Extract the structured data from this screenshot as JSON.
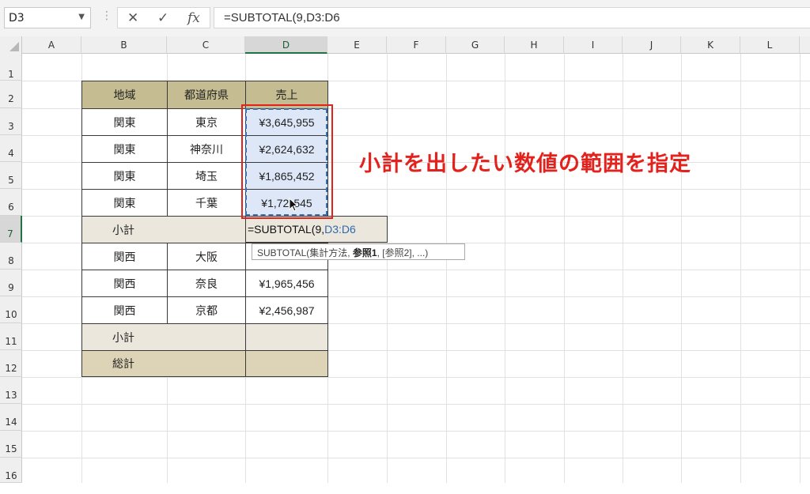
{
  "formula_bar": {
    "name_box": "D3",
    "cancel_icon": "✕",
    "enter_icon": "✓",
    "fx_label": "fx",
    "formula": "=SUBTOTAL(9,D3:D6"
  },
  "columns": [
    "A",
    "B",
    "C",
    "D",
    "E",
    "F",
    "G",
    "H",
    "I",
    "J",
    "K",
    "L"
  ],
  "rows": [
    "1",
    "2",
    "3",
    "4",
    "5",
    "6",
    "7",
    "8",
    "9",
    "10",
    "11",
    "12",
    "13",
    "14",
    "15",
    "16"
  ],
  "table": {
    "headers": {
      "region": "地域",
      "prefecture": "都道府県",
      "sales": "売上"
    },
    "rows": [
      {
        "region": "関東",
        "prefecture": "東京",
        "sales": "¥3,645,955"
      },
      {
        "region": "関東",
        "prefecture": "神奈川",
        "sales": "¥2,624,632"
      },
      {
        "region": "関東",
        "prefecture": "埼玉",
        "sales": "¥1,865,452"
      },
      {
        "region": "関東",
        "prefecture": "千葉",
        "sales": "¥1,72",
        "sales_tail": "545"
      },
      {
        "subtotal": "小計"
      },
      {
        "region": "関西",
        "prefecture": "大阪",
        "sales": ""
      },
      {
        "region": "関西",
        "prefecture": "奈良",
        "sales": "¥1,965,456"
      },
      {
        "region": "関西",
        "prefecture": "京都",
        "sales": "¥2,456,987"
      },
      {
        "subtotal": "小計",
        "sales": ""
      },
      {
        "total": "総計",
        "sales": ""
      }
    ]
  },
  "editing": {
    "prefix": "=SUBTOTAL(9,",
    "ref": "D3:D6"
  },
  "tooltip": {
    "func": "SUBTOTAL(",
    "arg1": "集計方法",
    "sep1": ", ",
    "arg2": "参照1",
    "rest": ", [参照2], ...)"
  },
  "annotation": "小計を出したい数値の範囲を指定",
  "colors": {
    "header_fill": "#c5bd91",
    "subtotal_fill": "#ebe7dc",
    "total_fill": "#ddd4b7",
    "accent": "#217346",
    "annotation": "#e3221e"
  }
}
